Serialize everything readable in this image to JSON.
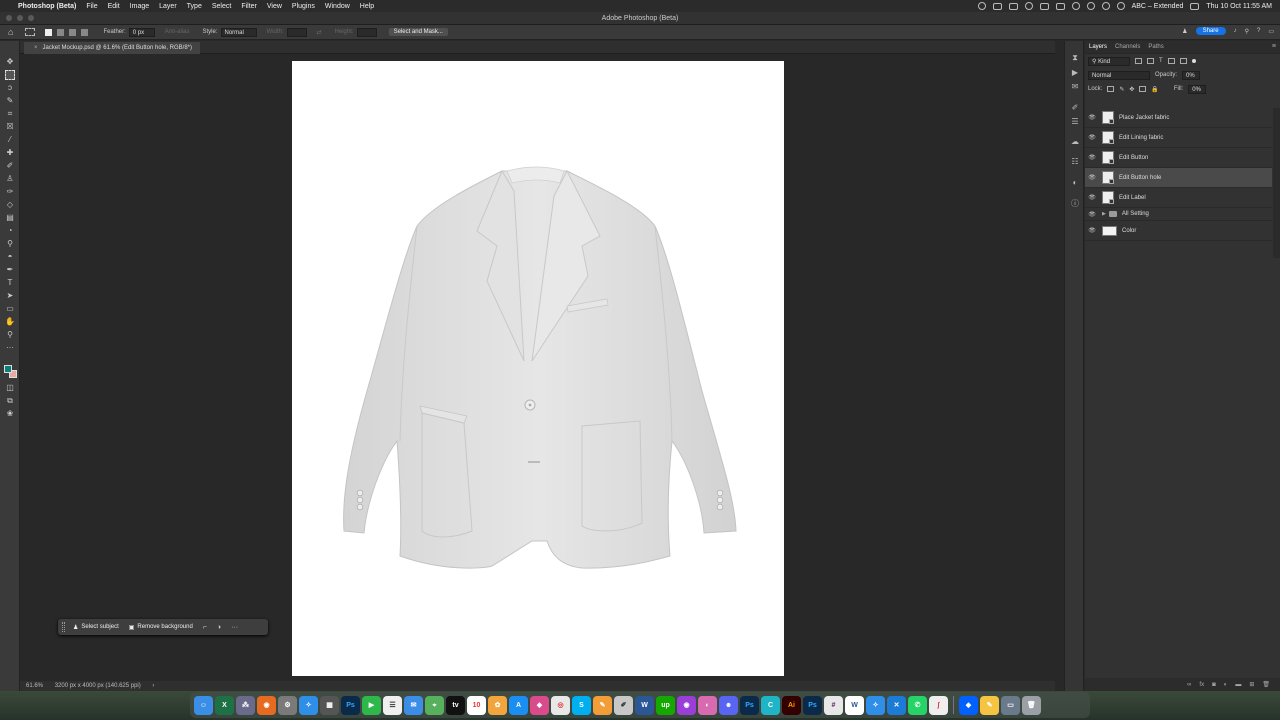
{
  "menubar": {
    "app_name": "Photoshop (Beta)",
    "menus": [
      "File",
      "Edit",
      "Image",
      "Layer",
      "Type",
      "Select",
      "Filter",
      "View",
      "Plugins",
      "Window",
      "Help"
    ],
    "input_source": "ABC – Extended",
    "datetime": "Thu 10 Oct  11:55 AM"
  },
  "window": {
    "title": "Adobe Photoshop (Beta)"
  },
  "options_bar": {
    "feather_label": "Feather:",
    "feather_value": "0 px",
    "anti_alias_label": "Anti-alias",
    "style_label": "Style:",
    "style_value": "Normal",
    "width_label": "Width:",
    "height_label": "Height:",
    "select_mask_label": "Select and Mask...",
    "share_label": "Share"
  },
  "document": {
    "tab_title": "Jacket Mockup.psd @ 61.6% (Edit Button hole, RGB/8*)",
    "close_glyph": "×"
  },
  "context_bar": {
    "select_subject": "Select subject",
    "remove_background": "Remove background",
    "more": "···"
  },
  "status_bar": {
    "zoom": "61.6%",
    "doc_info": "3200 px x 4000 px (140.625 ppi)",
    "arrow": "›"
  },
  "layers_panel": {
    "tabs": [
      "Layers",
      "Channels",
      "Paths"
    ],
    "active_tab": "Layers",
    "filter_label": "Kind",
    "blend_mode": "Normal",
    "opacity_label": "Opacity:",
    "opacity_value": "0%",
    "lock_label": "Lock:",
    "fill_label": "Fill:",
    "fill_value": "0%",
    "layers": [
      {
        "name": "Place Jacket fabric",
        "kind": "smart",
        "selected": false
      },
      {
        "name": "Edit Lining fabric",
        "kind": "smart",
        "selected": false
      },
      {
        "name": "Edit Button",
        "kind": "smart",
        "selected": false
      },
      {
        "name": "Edit Button hole",
        "kind": "smart",
        "selected": true
      },
      {
        "name": "Edit Label",
        "kind": "smart",
        "selected": false
      },
      {
        "name": "All Setting",
        "kind": "group",
        "selected": false
      },
      {
        "name": "Color",
        "kind": "fill",
        "selected": false
      }
    ],
    "footer_icons": [
      "link-icon",
      "fx-icon",
      "mask-icon",
      "adjustment-icon",
      "folder-icon",
      "new-layer-icon",
      "trash-icon"
    ]
  },
  "colors": {
    "foreground": "#0f7d7a",
    "background": "#e8a9a4",
    "accent": "#1473e6"
  },
  "dock": {
    "apps": [
      "Finder",
      "Excel",
      "Launchpad",
      "Firefox",
      "Settings",
      "Safari",
      "Calculator",
      "Photoshop",
      "FaceTime",
      "Reminders",
      "Mail",
      "Maps",
      "Apple TV",
      "Calendar",
      "Photos",
      "App Store",
      "CleanMyMac",
      "Chrome",
      "Skype",
      "Pages",
      "Script Editor",
      "Word",
      "Upwork",
      "Podcasts",
      "Preview",
      "Discord",
      "Photoshop 2",
      "Canva",
      "Illustrator",
      "Photoshop Beta",
      "Slack",
      "Word Web",
      "Safari 2",
      "Xcode",
      "WhatsApp",
      "Instruments",
      "Dropbox",
      "Notes",
      "Desktop",
      "Trash"
    ],
    "calendar_day": "10"
  }
}
